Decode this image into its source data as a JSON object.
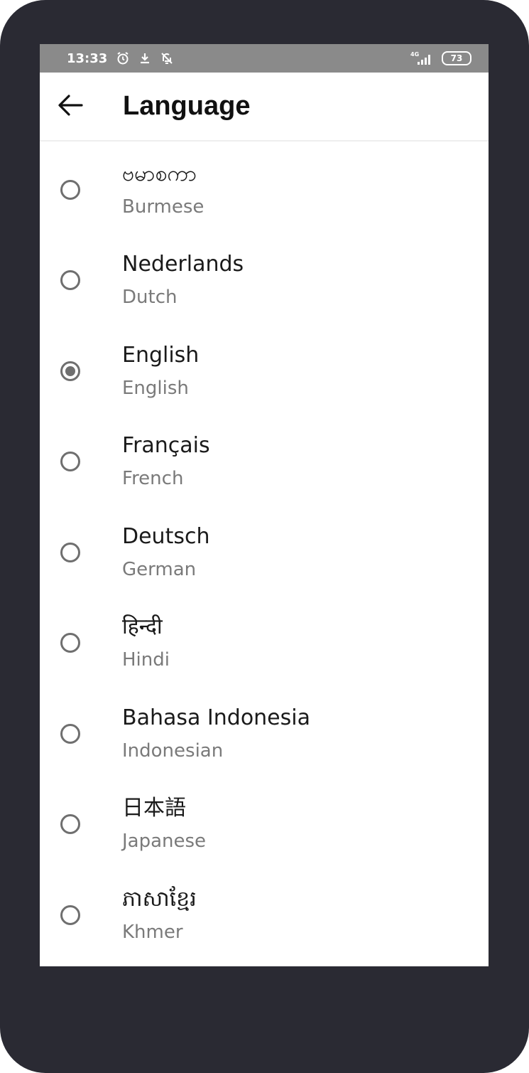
{
  "status_bar": {
    "time": "13:33",
    "network": "4G",
    "battery": "73"
  },
  "toolbar": {
    "title": "Language"
  },
  "languages": [
    {
      "native": "ဗမာစကာ",
      "english": "Burmese",
      "selected": false
    },
    {
      "native": "Nederlands",
      "english": "Dutch",
      "selected": false
    },
    {
      "native": "English",
      "english": "English",
      "selected": true
    },
    {
      "native": "Français",
      "english": "French",
      "selected": false
    },
    {
      "native": "Deutsch",
      "english": "German",
      "selected": false
    },
    {
      "native": "हिन्दी",
      "english": "Hindi",
      "selected": false
    },
    {
      "native": "Bahasa Indonesia",
      "english": "Indonesian",
      "selected": false
    },
    {
      "native": "日本語",
      "english": "Japanese",
      "selected": false
    },
    {
      "native": "ភាសាខ្មែរ",
      "english": "Khmer",
      "selected": false
    }
  ],
  "icons": {
    "back": "arrow-left-icon",
    "alarm": "alarm-icon",
    "download": "download-icon",
    "notifications_off": "bell-off-icon",
    "signal": "signal-icon",
    "battery": "battery-icon"
  },
  "colors": {
    "frame": "#2a2a33",
    "status_bar": "#8a8a8a",
    "radio": "#6f6f6f",
    "primary_text": "#1a1a1a",
    "secondary_text": "#7a7a7a"
  }
}
